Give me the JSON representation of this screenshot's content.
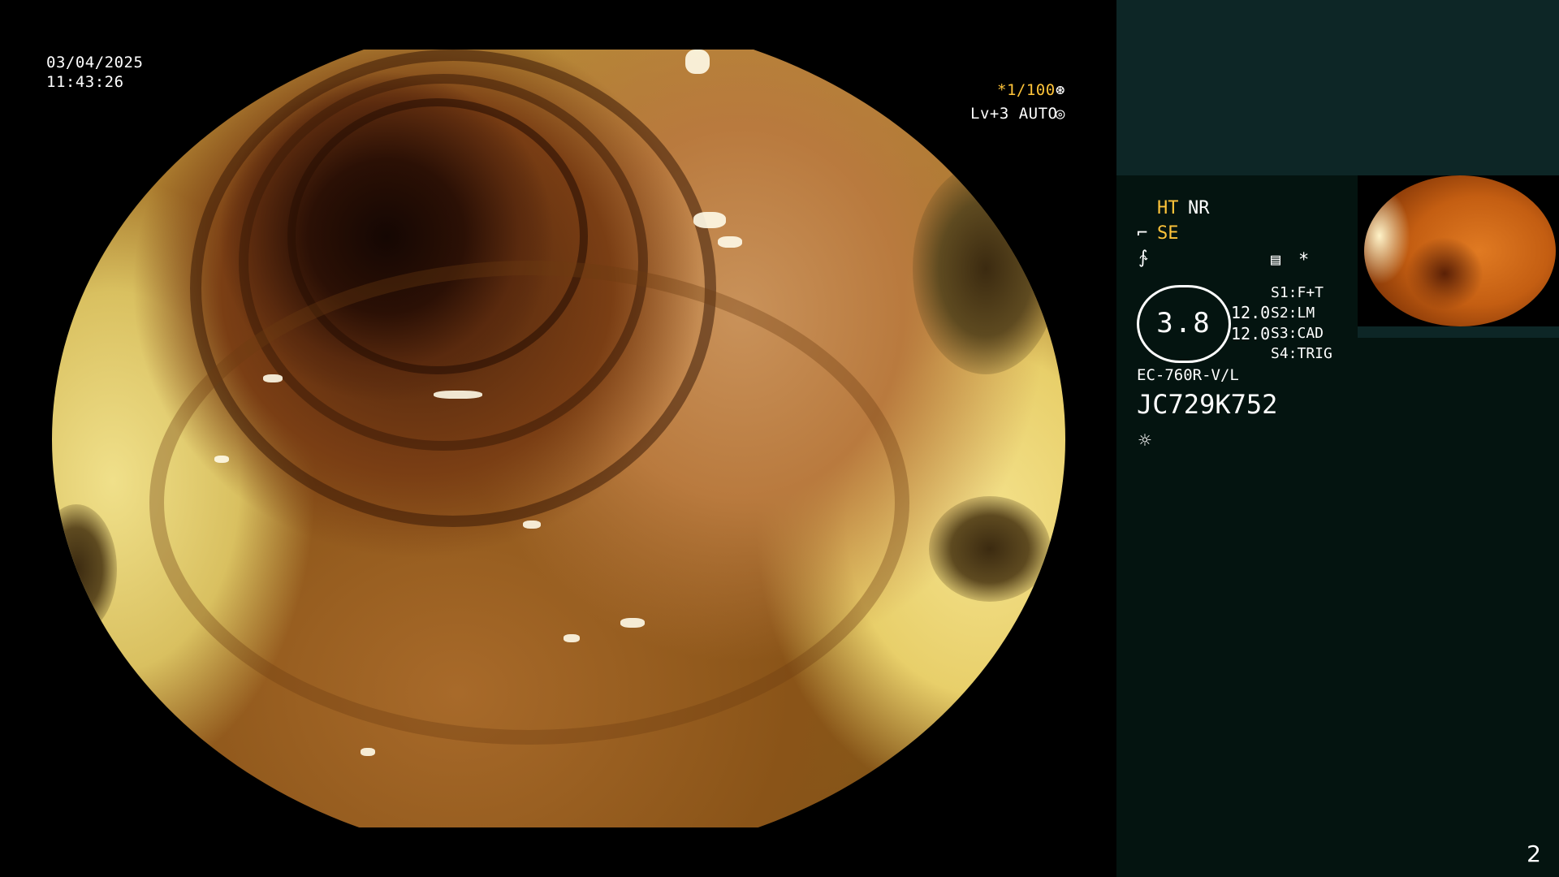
{
  "overlay": {
    "date": "03/04/2025",
    "time": "11:43:26",
    "shutter": "*1/100",
    "level": "Lv+3 AUTO"
  },
  "panel": {
    "ht": "HT",
    "nr": "NR",
    "se": "SE",
    "gauge_value": "3.8",
    "val1": "12.0",
    "val2": "12.0",
    "settings": [
      "S1:F+T",
      "S2:LM",
      "S3:CAD",
      "S4:TRIG"
    ],
    "scope_model": "EC-760R-V/L",
    "serial": "JC729K752",
    "asterisk": "*"
  },
  "page_number": "2",
  "colors": {
    "accent_yellow": "#ffc43a",
    "panel_bg": "#041410",
    "panel_top_bg": "#0d2626"
  },
  "icons": [
    "shutter-icon",
    "auto-icon",
    "mode-icon",
    "curve-icon",
    "record-icon",
    "light-icon"
  ]
}
